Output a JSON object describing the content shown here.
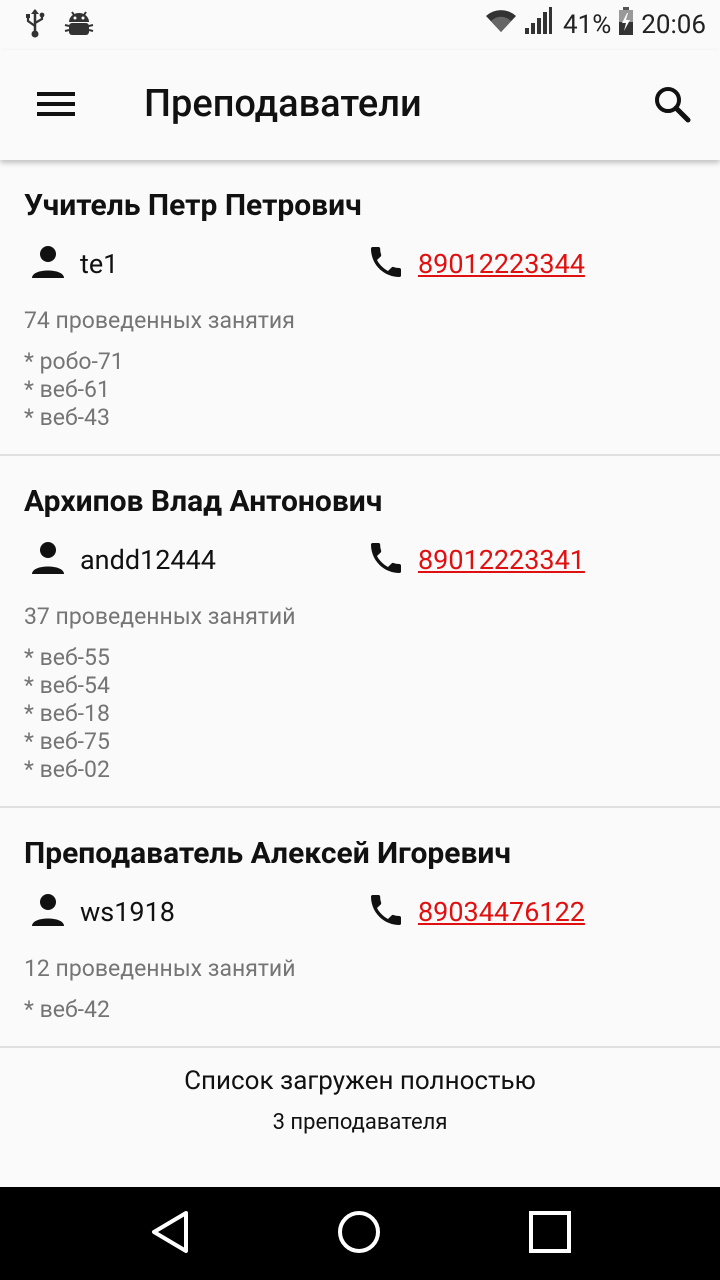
{
  "status_bar": {
    "battery_percent": "41%",
    "time": "20:06",
    "left_icons": [
      "usb-icon",
      "android-debug-icon"
    ],
    "right_icons": [
      "wifi-icon",
      "signal-icon",
      "battery-charging-icon"
    ]
  },
  "toolbar": {
    "title": "Преподаватели",
    "menu_icon": "menu-icon",
    "search_icon": "search-icon"
  },
  "teachers": [
    {
      "name": "Учитель Петр Петрович",
      "login": "te1",
      "phone": "89012223344",
      "lessons": "74 проведенных занятия",
      "groups": [
        "* робо-71",
        "* веб-61",
        "* веб-43"
      ]
    },
    {
      "name": "Архипов Влад Антонович",
      "login": "andd12444",
      "phone": "89012223341",
      "lessons": "37 проведенных занятий",
      "groups": [
        "* веб-55",
        "* веб-54",
        "* веб-18",
        "* веб-75",
        "* веб-02"
      ]
    },
    {
      "name": "Преподаватель Алексей Игоревич",
      "login": "ws1918",
      "phone": "89034476122",
      "lessons": "12 проведенных занятий",
      "groups": [
        "* веб-42"
      ]
    }
  ],
  "footer": {
    "status": "Список загружен полностью",
    "count": "3 преподавателя"
  },
  "colors": {
    "phone_link": "#e01010",
    "secondary_text": "#757575",
    "background": "#fafafa",
    "divider": "#e0e0e0"
  },
  "nav_bar": {
    "buttons": [
      "back-icon",
      "home-icon",
      "recents-icon"
    ]
  }
}
